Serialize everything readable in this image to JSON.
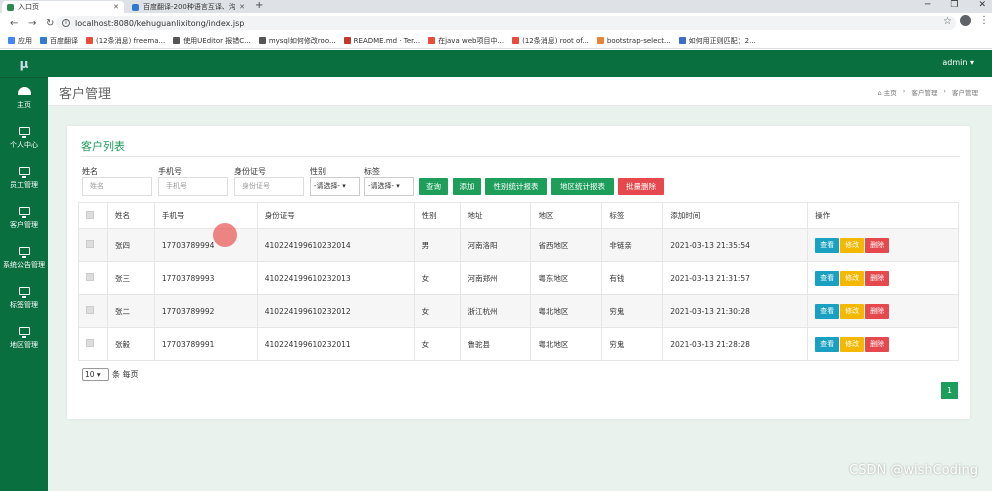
{
  "browser": {
    "tabs": [
      {
        "label": "入口页",
        "color": "#2a8a50"
      },
      {
        "label": "百度翻译-200种语言互译、沟通",
        "color": "#2e7ad1"
      }
    ],
    "url": "localhost:8080/kehuguanlixitong/index.jsp",
    "bookmarks": [
      {
        "label": "应用",
        "color": "#4285f4"
      },
      {
        "label": "百度翻译",
        "color": "#2e7ad1"
      },
      {
        "label": "(12条消息) freema...",
        "color": "#e84c3d"
      },
      {
        "label": "使用UEditor 报错C...",
        "color": "#555555"
      },
      {
        "label": "mysql如何修改roo...",
        "color": "#555555"
      },
      {
        "label": "README.md · Ter...",
        "color": "#c0392b"
      },
      {
        "label": "在java web项目中...",
        "color": "#e84c3d"
      },
      {
        "label": "(12条消息) root of...",
        "color": "#e84c3d"
      },
      {
        "label": "bootstrap-select...",
        "color": "#e8833a"
      },
      {
        "label": "如何用正则匹配：2...",
        "color": "#3b6ec9"
      }
    ]
  },
  "sidebar": {
    "logo": "μ",
    "items": [
      {
        "label": "主页",
        "icon": "dashboard-icon"
      },
      {
        "label": "个人中心",
        "icon": "monitor-icon"
      },
      {
        "label": "员工管理",
        "icon": "monitor-icon"
      },
      {
        "label": "客户管理",
        "icon": "monitor-icon"
      },
      {
        "label": "系统公告管理",
        "icon": "monitor-icon"
      },
      {
        "label": "标签管理",
        "icon": "monitor-icon"
      },
      {
        "label": "地区管理",
        "icon": "monitor-icon"
      }
    ]
  },
  "topbar": {
    "user": "admin ▾"
  },
  "page": {
    "title": "客户管理",
    "breadcrumb": [
      "⌂ 主页",
      "›",
      "客户管理",
      "›",
      "客户管理"
    ]
  },
  "card": {
    "title": "客户列表"
  },
  "filters": {
    "name": {
      "label": "姓名",
      "placeholder": "姓名"
    },
    "phone": {
      "label": "手机号",
      "placeholder": "手机号"
    },
    "idcard": {
      "label": "身份证号",
      "placeholder": "身份证号"
    },
    "gender": {
      "label": "性别",
      "value": "-请选择- ▾"
    },
    "tag": {
      "label": "标签",
      "value": "-请选择- ▾"
    }
  },
  "buttons": {
    "query": "查询",
    "add": "添加",
    "gender_stats": "性别统计报表",
    "region_stats": "地区统计报表",
    "batch_delete": "批量删除"
  },
  "table": {
    "columns": [
      "",
      "姓名",
      "手机号",
      "身份证号",
      "性别",
      "地址",
      "地区",
      "标签",
      "添加时间",
      "操作"
    ],
    "rows": [
      [
        "张四",
        "17703789994",
        "410224199610232014",
        "男",
        "河南洛阳",
        "省西地区",
        "非链亲",
        "2021-03-13 21:35:54"
      ],
      [
        "张三",
        "17703789993",
        "410224199610232013",
        "女",
        "河南郑州",
        "粤东地区",
        "有钱",
        "2021-03-13 21:31:57"
      ],
      [
        "张二",
        "17703789992",
        "410224199610232012",
        "女",
        "浙江杭州",
        "粤北地区",
        "穷鬼",
        "2021-03-13 21:30:28"
      ],
      [
        "张毅",
        "17703789991",
        "410224199610232011",
        "女",
        "鲁驼县",
        "粤北地区",
        "穷鬼",
        "2021-03-13 21:28:28"
      ]
    ],
    "actions": {
      "view": "查看",
      "edit": "修改",
      "delete": "删除"
    }
  },
  "pagination": {
    "page_size": "10 ▾",
    "page_size_suffix": "条 每页",
    "current_page": "1"
  },
  "watermark": "CSDN @wishCoding"
}
